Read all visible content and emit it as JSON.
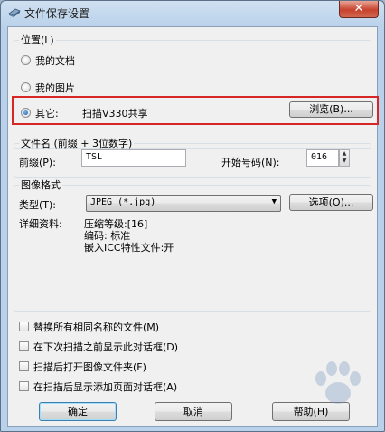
{
  "window": {
    "title": "文件保存设置",
    "close_label": "✕"
  },
  "location": {
    "legend": "位置(L)",
    "options": [
      {
        "label": "我的文档",
        "checked": false
      },
      {
        "label": "我的图片",
        "checked": false
      },
      {
        "label": "其它:",
        "checked": true
      }
    ],
    "other_path": "扫描V330共享",
    "browse_label": "浏览(B)..."
  },
  "filename": {
    "legend": "文件名 (前缀 + 3位数字)",
    "prefix_label": "前缀(P):",
    "prefix_value": "TSL",
    "start_label": "开始号码(N):",
    "start_value": "016"
  },
  "format": {
    "legend": "图像格式",
    "type_label": "类型(T):",
    "type_value": "JPEG (*.jpg)",
    "options_label": "选项(O)...",
    "details_label": "详细资料:",
    "details": [
      "压缩等级:[16]",
      "编码: 标准",
      "嵌入ICC特性文件:开"
    ]
  },
  "checkboxes": [
    "替换所有相同名称的文件(M)",
    "在下次扫描之前显示此对话框(D)",
    "扫描后打开图像文件夹(F)",
    "在扫描后显示添加页面对话框(A)"
  ],
  "buttons": {
    "ok": "确定",
    "cancel": "取消",
    "help": "帮助(H)"
  }
}
